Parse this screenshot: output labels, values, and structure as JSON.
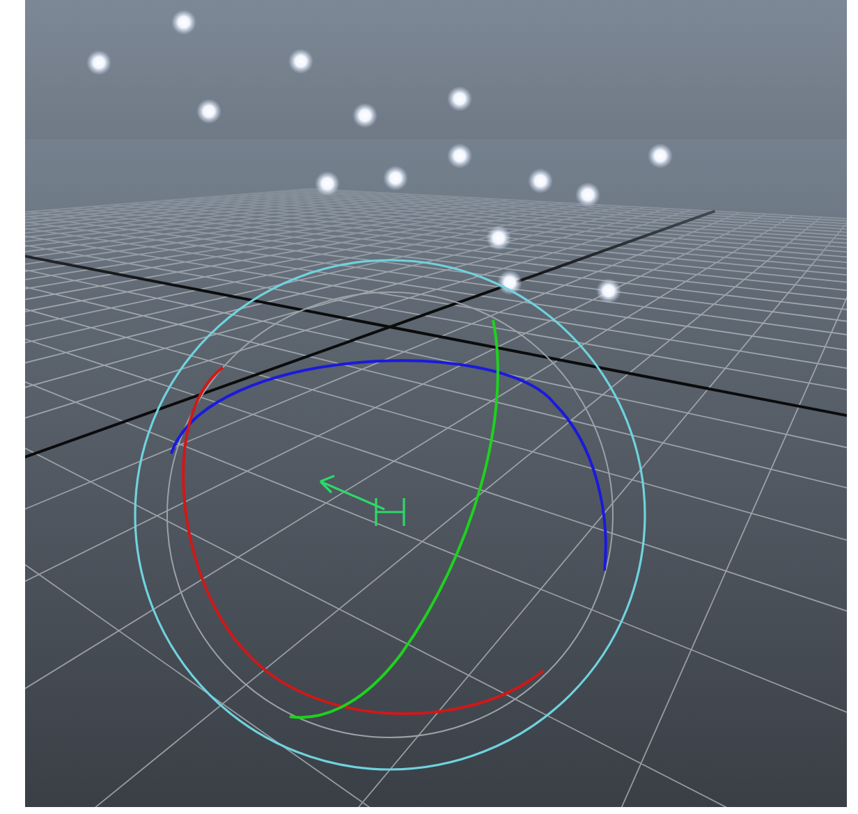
{
  "viewport": {
    "grid": true,
    "rotate_manipulator": true
  }
}
